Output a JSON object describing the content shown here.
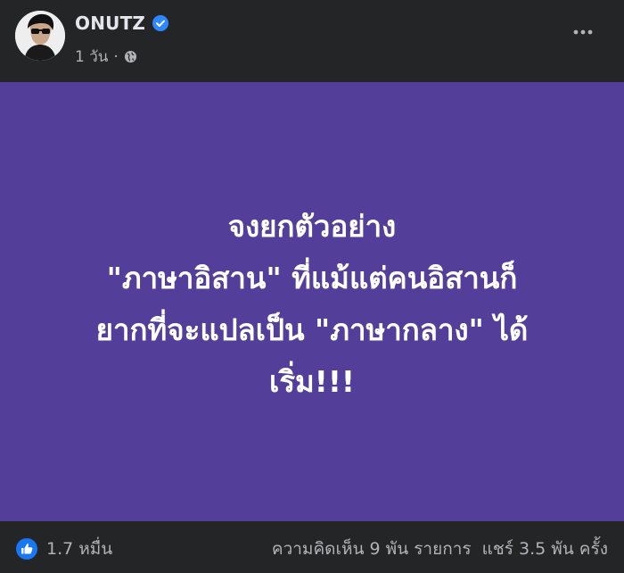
{
  "post": {
    "author": "ONUTZ",
    "timestamp": "1 วัน",
    "separator": "·",
    "privacy_icon": "globe-icon",
    "verified_icon": "verified-badge-icon",
    "more_icon": "more-dots-icon",
    "background_color": "#533f99",
    "text_lines": [
      "จงยกตัวอย่าง",
      "\"ภาษาอิสาน\" ที่แม้แต่คนอิสานก็",
      "ยากที่จะแปลเป็น \"ภาษากลาง\" ได้",
      "เริ่ม!!!"
    ]
  },
  "footer": {
    "reaction_icon": "like-icon",
    "reaction_count": "1.7 หมื่น",
    "comments": "ความคิดเห็น 9 พัน รายการ",
    "shares": "แชร์ 3.5 พัน ครั้ง"
  },
  "colors": {
    "page_background": "#242526",
    "post_background": "#533f99",
    "verified_blue": "#2d88ff",
    "like_blue": "#1877f2"
  }
}
